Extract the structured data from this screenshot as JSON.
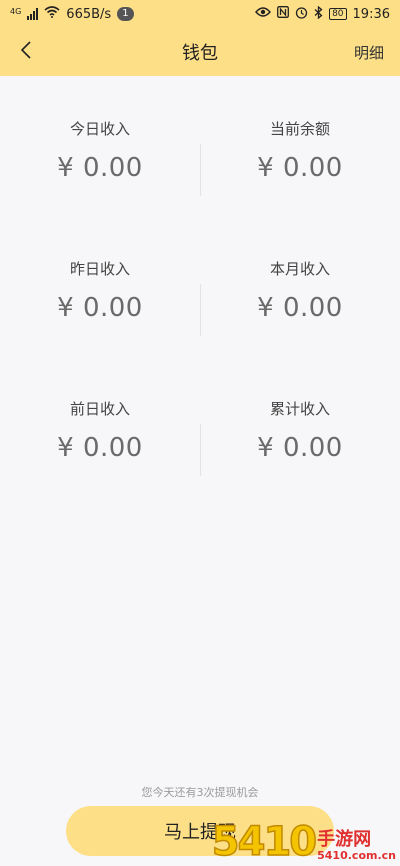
{
  "status_bar": {
    "network": "4G",
    "speed": "665B/s",
    "notifications": "1",
    "battery": "80",
    "time": "19:36"
  },
  "nav": {
    "title": "钱包",
    "detail_label": "明细"
  },
  "stats": [
    {
      "label": "今日收入",
      "value": "¥ 0.00"
    },
    {
      "label": "当前余额",
      "value": "¥ 0.00"
    },
    {
      "label": "昨日收入",
      "value": "¥ 0.00"
    },
    {
      "label": "本月收入",
      "value": "¥ 0.00"
    },
    {
      "label": "前日收入",
      "value": "¥ 0.00"
    },
    {
      "label": "累计收入",
      "value": "¥ 0.00"
    }
  ],
  "withdraw": {
    "chances_text": "您今天还有3次提现机会",
    "button_label": "马上提现"
  },
  "watermark": {
    "number": "5410",
    "site_cn": "手游网",
    "site_url": "5410.com.cn"
  },
  "colors": {
    "accent": "#fddf87",
    "background": "#f7f7f9"
  }
}
